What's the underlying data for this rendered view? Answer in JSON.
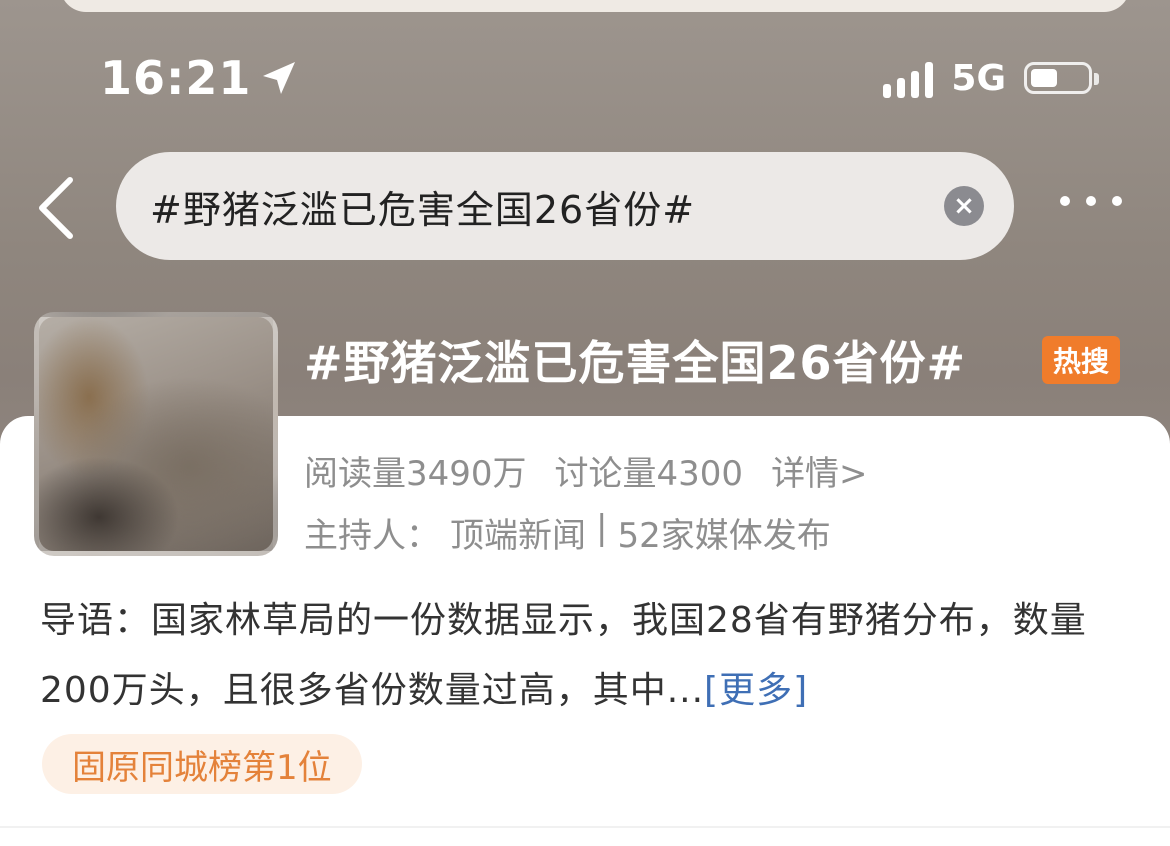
{
  "status_bar": {
    "time": "16:21",
    "network": "5G"
  },
  "search": {
    "query": "#野猪泛滥已危害全国26省份#",
    "clear_icon": "×"
  },
  "topic": {
    "title": "#野猪泛滥已危害全国26省份#",
    "badge": "热搜",
    "reads": "阅读量3490万",
    "discussions": "讨论量4300",
    "details_link": "详情>",
    "host_label": "主持人：",
    "host_name": "顶端新闻",
    "separator": "|",
    "media": "52家媒体发布",
    "intro": "导语：国家林草局的一份数据显示，我国28省有野猪分布，数量200万头，且很多省份数量过高，其中...",
    "more_link": "[更多]",
    "rank": "固原同城榜第1位"
  },
  "colors": {
    "hot_badge": "#f07c2b",
    "link": "#3f6fb5",
    "rank_text": "#e4823a",
    "rank_bg": "#fdf0e5"
  },
  "icons": {
    "location": "location-arrow-icon",
    "signal": "signal-icon",
    "battery": "battery-icon",
    "back": "chevron-left-icon",
    "clear": "clear-icon",
    "more": "more-dots-icon"
  }
}
